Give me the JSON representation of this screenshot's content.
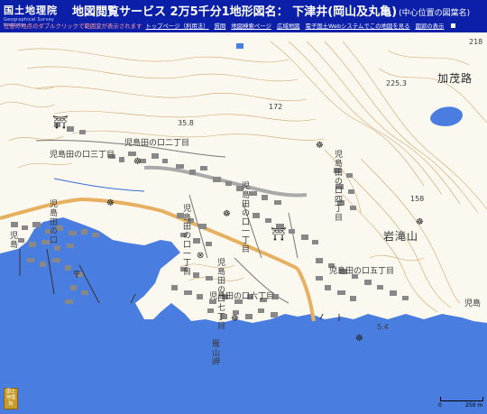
{
  "header": {
    "logo_ja": "国土地理院",
    "logo_en": "Geographical Survey Institute",
    "title": "地図閲覧サービス 2万5千分1地形図名： 下津井(岡山及丸亀)",
    "title_sub": "(中心位置の図葉名)"
  },
  "subbar": {
    "hint": "任意の地点のダブルクリックで範囲変が表示されます",
    "links": [
      "トップページ（利用法）",
      "質問",
      "地図検索ページ",
      "広域地図",
      "電子国土Webシステムでこの地図を見る",
      "図郭の表示"
    ]
  },
  "map": {
    "labels": {
      "kamo": "加茂路",
      "iwataki": "岩滝山",
      "nokoro2": "児島田の口二丁目",
      "nokoro3": "児島田の口三丁目",
      "nokoro4": "児島田の口四丁目",
      "nokoro5": "児島田の口五丁目",
      "nokoro6": "児島田の口六丁目",
      "nokoro7": "児島田の口七丁目",
      "nokoro_v1": "児島田の口一丁目",
      "nokoro_v2": "児島田の口一丁目",
      "nokoro_v3": "児島田の口",
      "kojima_edge": "児島",
      "kojima_west": "児島",
      "karyama": "雁山岬",
      "spot_218": "218",
      "spot_2253": "225.3",
      "spot_172": "172",
      "spot_158": "158",
      "spot_54": "5.4",
      "spot_358": "35.8"
    }
  },
  "scale": {
    "zero": "0",
    "dist": "250 m"
  },
  "badge": "国土地理院"
}
